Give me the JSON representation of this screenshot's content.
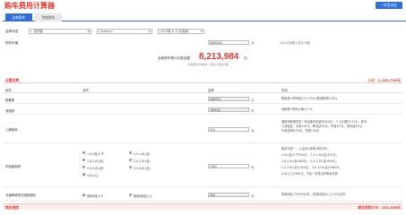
{
  "app": {
    "title": "购车费用计算器",
    "corner_button": "+车型对比"
  },
  "tabs": [
    {
      "label": "全款购车",
      "active": true
    },
    {
      "label": "贷款购车",
      "active": false
    }
  ],
  "selection": {
    "label": "选择车型",
    "brand": "L 保时捷",
    "series": "Cayenne",
    "model": "2013款 Cayenne S",
    "series_alt": "",
    "model_alt": "2013款 6.7L 标准版"
  },
  "price": {
    "label": "购车价格",
    "value": "8880000",
    "unit": "元",
    "note": "(可以手动输入成交价格)"
  },
  "total": {
    "label": "全款购车预计花费总额",
    "value": "8,213,984",
    "unit": "元",
    "sub": "此结果仅供参考，实际以当地为准"
  },
  "required_section": {
    "name": "必要花费",
    "subtotal": "小计：1,183,798元"
  },
  "table_headers": {
    "item": "款项",
    "option": "选项",
    "amount": "金额",
    "desc": "说明"
  },
  "rows": {
    "purchase_tax": {
      "label": "购置税",
      "amount": "588034",
      "unit": "元",
      "desc": "购置税=购车款/(1+17%)×购置税率(10%)"
    },
    "consumption_tax": {
      "label": "消费税",
      "amount": "588034",
      "unit": "元",
      "desc": "消费税=购车价格×17%"
    },
    "license_fee": {
      "label": "上牌费用",
      "amount": "500",
      "unit": "元",
      "desc_lines": [
        "通常商家提供的一条龙服务收费约500元，个人办理约373元，其中",
        "工商验证、出库150元，移动证30元，环保卡3元，拓号费40元，",
        "行驶证照片20元，托盘150元"
      ]
    },
    "vehicle_tax": {
      "label": "车船使用税",
      "amount": "5280",
      "unit": "元",
      "options": [
        {
          "label": "1.0L(含)以下",
          "selected": false
        },
        {
          "label": "1.0-1.6L(含)",
          "selected": false
        },
        {
          "label": "1.6-2.0L(含)",
          "selected": false
        },
        {
          "label": "2.0-2.5L(含)",
          "selected": false
        },
        {
          "label": "2.5-3.0L(含)",
          "selected": false
        },
        {
          "label": "3.0-4.0L(含)",
          "selected": false
        },
        {
          "label": "4.0L以上",
          "selected": true
        }
      ],
      "desc_lines": [
        "各省不统一，以北京为参考(单位/年)：",
        "1.0L(含)以下300元；    1.0-1.6L(含)420元；",
        "1.6-2.0L(含)480元；    2.0-2.5L(含)900元；",
        "2.5-3.0L(含)1920元；   3.0-4.0L(含)3480元；",
        "4.0L以上5280元；不足一年按当年剩余月算"
      ]
    },
    "compulsory_insurance": {
      "label": "交通事故责任强制保险",
      "amount": "950",
      "unit": "元",
      "options": [
        {
          "label": "家用6座以下",
          "selected": true
        },
        {
          "label": "家用6座及以上",
          "selected": false
        }
      ],
      "desc": "家用6座以下950元/年，家用6座及以上1100元/年"
    }
  },
  "commercial_section": {
    "name": "商业保险",
    "subtotal": "商业保险小计：151,186元"
  },
  "colors": {
    "accent": "#e53a2f",
    "primary": "#2f6fd6"
  }
}
